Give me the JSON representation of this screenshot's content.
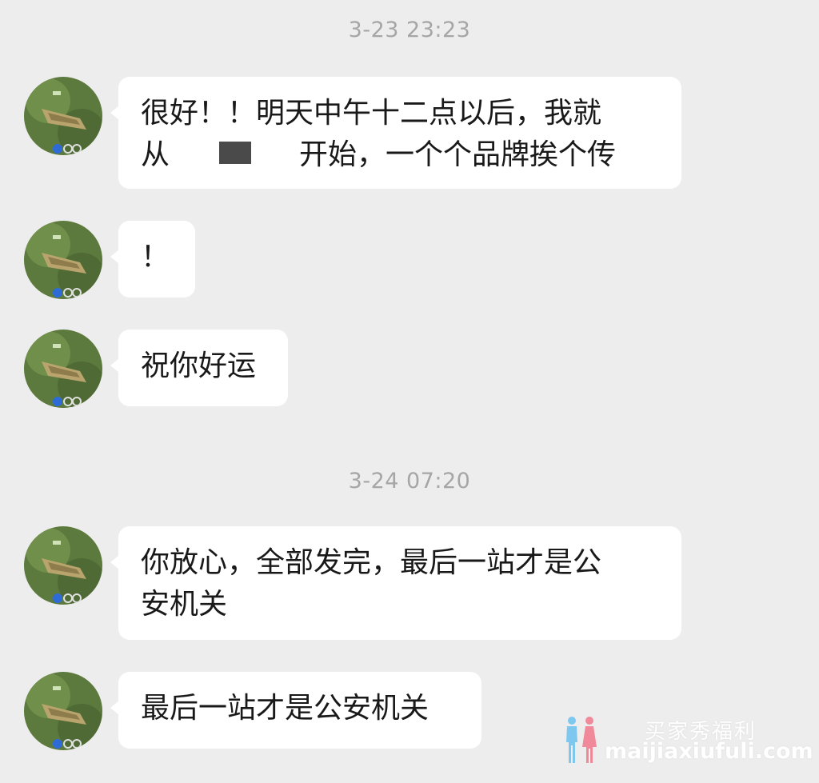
{
  "chat": {
    "timestamps": [
      "3-23 23:23",
      "3-24 07:20"
    ],
    "messages": [
      {
        "line1": "很好！！明天中午十二点以后，我就",
        "line2_start": "从",
        "line2_end": "开始，一个个品牌挨个传",
        "redacted": true
      },
      {
        "text": "！"
      },
      {
        "text": "祝你好运"
      },
      {
        "text": "你放心，全部发完，最后一站才是公\n安机关"
      },
      {
        "text": "最后一站才是公安机关"
      }
    ]
  },
  "watermark": {
    "chinese": "买家秀福利",
    "domain": "maijiaxiufuli.com"
  },
  "colors": {
    "background": "#ededed",
    "bubble": "#ffffff",
    "text": "#191919",
    "timestamp": "#a6a6a6"
  },
  "icons": [
    "avatar-game-scene",
    "couple-silhouette-icon"
  ]
}
